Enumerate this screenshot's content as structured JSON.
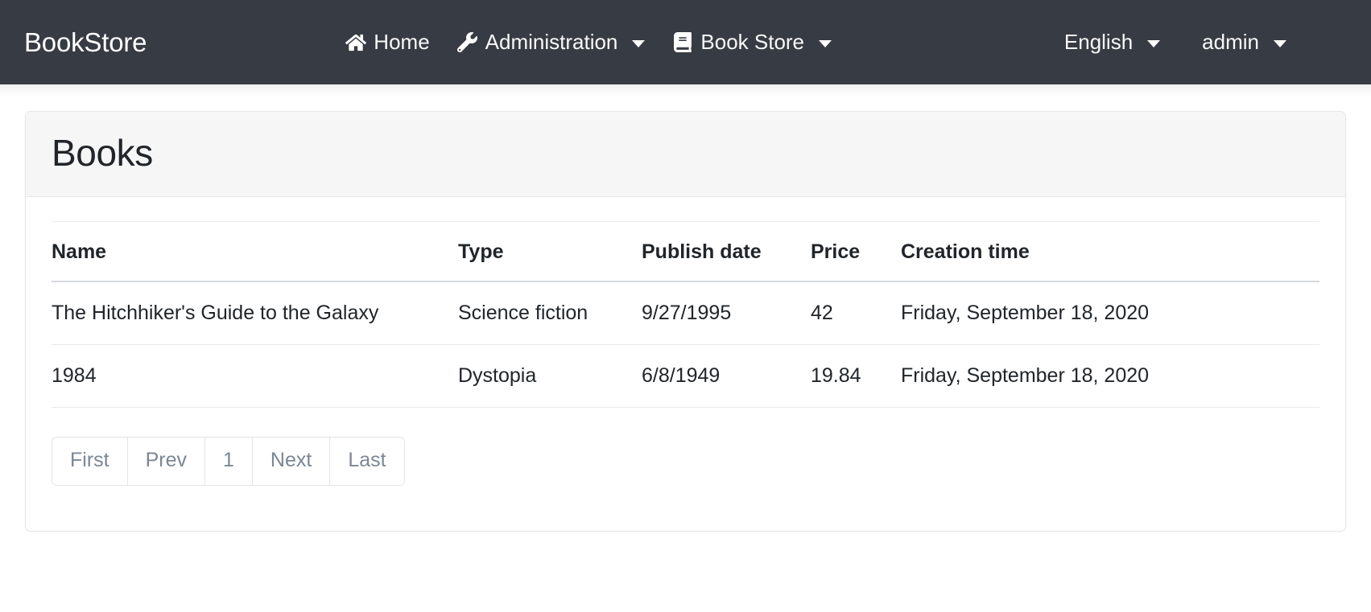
{
  "navbar": {
    "brand": "BookStore",
    "center_items": [
      {
        "label": "Home",
        "icon": "home-icon",
        "has_caret": false
      },
      {
        "label": "Administration",
        "icon": "wrench-icon",
        "has_caret": true
      },
      {
        "label": "Book Store",
        "icon": "book-icon",
        "has_caret": true
      }
    ],
    "right_items": [
      {
        "label": "English",
        "has_caret": true
      },
      {
        "label": "admin",
        "has_caret": true
      }
    ]
  },
  "card": {
    "title": "Books"
  },
  "table": {
    "columns": [
      "Name",
      "Type",
      "Publish date",
      "Price",
      "Creation time"
    ],
    "rows": [
      {
        "name": "The Hitchhiker's Guide to the Galaxy",
        "type": "Science fiction",
        "publish_date": "9/27/1995",
        "price": "42",
        "creation_time": "Friday, September 18, 2020"
      },
      {
        "name": "1984",
        "type": "Dystopia",
        "publish_date": "6/8/1949",
        "price": "19.84",
        "creation_time": "Friday, September 18, 2020"
      }
    ]
  },
  "pagination": {
    "first": "First",
    "prev": "Prev",
    "page_1": "1",
    "next": "Next",
    "last": "Last"
  },
  "colors": {
    "navbar_bg": "#373b43",
    "card_header_bg": "#f6f6f7",
    "card_border": "#e7e7e9",
    "text": "#212529",
    "muted": "#7b8794"
  }
}
